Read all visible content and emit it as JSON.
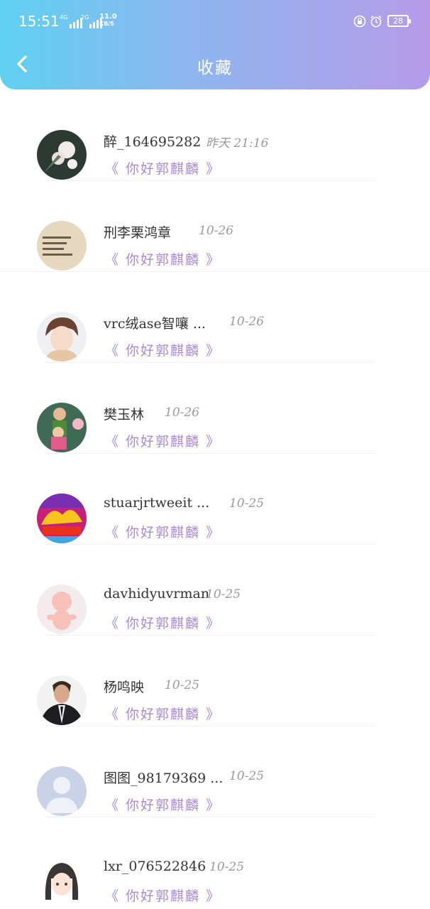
{
  "status_bar": {
    "time": "15:51",
    "signal1_label": "4G",
    "signal2_label": "2G",
    "speed_value": "11.0",
    "speed_unit": "KB/S",
    "battery": "28"
  },
  "header": {
    "title": "收藏"
  },
  "items": [
    {
      "name": "醉_164695282",
      "date": "昨天 21:16",
      "favorite": "《 你好郭麒麟 》",
      "avatar_icon": "flower-photo-avatar"
    },
    {
      "name": "刑李栗鸿章",
      "date": "10-26",
      "favorite": "《 你好郭麒麟 》",
      "avatar_icon": "handwritten-note-avatar"
    },
    {
      "name": "vrc绒ase智嚷 ...",
      "date": "10-26",
      "favorite": "《 你好郭麒麟 》",
      "avatar_icon": "anime-boy-avatar"
    },
    {
      "name": "樊玉林",
      "date": "10-26",
      "favorite": "《 你好郭麒麟 》",
      "avatar_icon": "children-photo-avatar"
    },
    {
      "name": "stuarjrtweeit ...",
      "date": "10-25",
      "favorite": "《 你好郭麒麟 》",
      "avatar_icon": "colorful-banner-avatar"
    },
    {
      "name": "davhidyuvrman",
      "date": "10-25",
      "favorite": "《 你好郭麒麟 》",
      "avatar_icon": "baby-doll-avatar"
    },
    {
      "name": "杨鸣映",
      "date": "10-25",
      "favorite": "《 你好郭麒麟 》",
      "avatar_icon": "man-in-suit-avatar"
    },
    {
      "name": "图图_98179369 ...",
      "date": "10-25",
      "favorite": "《 你好郭麒麟 》",
      "avatar_icon": "default-user-avatar"
    },
    {
      "name": "lxr_076522846",
      "date": "10-25",
      "favorite": "《 你好郭麒麟 》",
      "avatar_icon": "anime-girl-avatar"
    }
  ],
  "colors": {
    "header_gradient_start": "#5fd0f0",
    "header_gradient_end": "#b69be8",
    "favorite_text": "#a88ad8",
    "name_text": "#333333",
    "date_text": "#9a9a9a"
  }
}
